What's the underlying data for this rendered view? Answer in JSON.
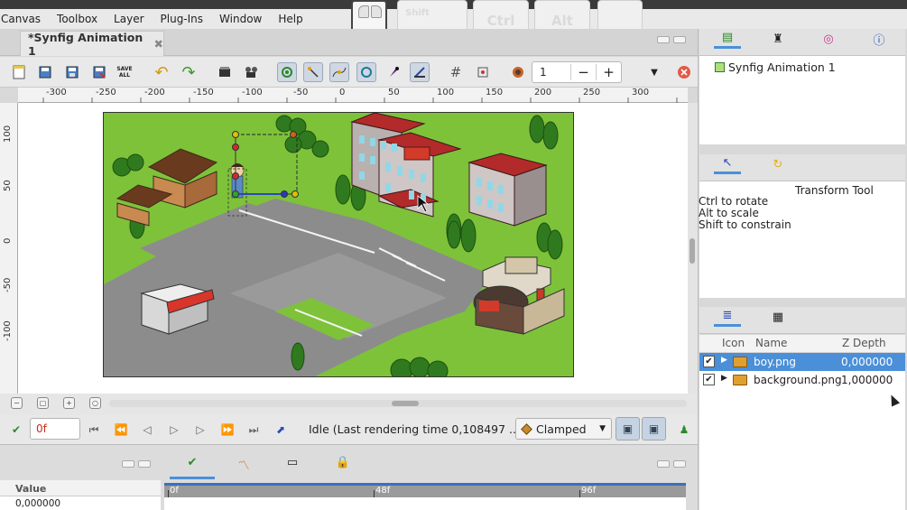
{
  "menubar": {
    "items": [
      "Canvas",
      "Toolbox",
      "Layer",
      "Plug-Ins",
      "Window",
      "Help"
    ]
  },
  "key_overlay": {
    "keys": [
      "Shift",
      "Ctrl",
      "Alt",
      ""
    ],
    "mouse": "mouse-icon"
  },
  "document": {
    "tab_title": "*Synfig Animation 1",
    "close_glyph": "✖"
  },
  "toolbar": {
    "frame_value": "1",
    "minus": "−",
    "plus": "+",
    "icons": [
      "new-file-icon",
      "open-file-icon",
      "save-icon",
      "save-as-icon",
      "save-all-icon",
      "undo-icon",
      "redo-icon",
      "render-icon",
      "preview-icon",
      "onion-skin-icon",
      "toggle-ducks-icon",
      "bline-icon",
      "circle-icon",
      "draw-icon",
      "transform-icon",
      "grid-icon",
      "snap-icon",
      "background-color-icon",
      "dropdown-icon",
      "stop-render-icon"
    ]
  },
  "rulers": {
    "horizontal": [
      "-300",
      "-250",
      "-200",
      "-150",
      "-100",
      "-50",
      "0",
      "50",
      "100",
      "150",
      "200",
      "250",
      "300"
    ],
    "vertical": [
      "100",
      "50",
      "0",
      "-50",
      "-100"
    ]
  },
  "playback": {
    "time": "0f",
    "status": "Idle (Last rendering time 0,108497 ...",
    "interpolation": "Clamped",
    "interpolation_color": "#c98a2a"
  },
  "params": {
    "header": "Value",
    "value": "0,000000"
  },
  "timeline": {
    "marks": [
      "0f",
      "48f",
      "96f"
    ]
  },
  "canvas_browser": {
    "item": "Synfig Animation 1"
  },
  "tool_options": {
    "title": "Transform Tool",
    "hints": [
      "Ctrl to rotate",
      "Alt to scale",
      "Shift to constrain"
    ]
  },
  "layers": {
    "columns": [
      "Icon",
      "Name",
      "Z Depth"
    ],
    "rows": [
      {
        "name": "boy.png",
        "z": "0,000000",
        "selected": true
      },
      {
        "name": "background.png",
        "z": "1,000000",
        "selected": false
      }
    ]
  },
  "colors": {
    "accent": "#4a90d9",
    "selection": "#4a8fd8",
    "grass": "#7ec23a",
    "road": "#8c8c8c",
    "roof": "#b32a2a"
  }
}
